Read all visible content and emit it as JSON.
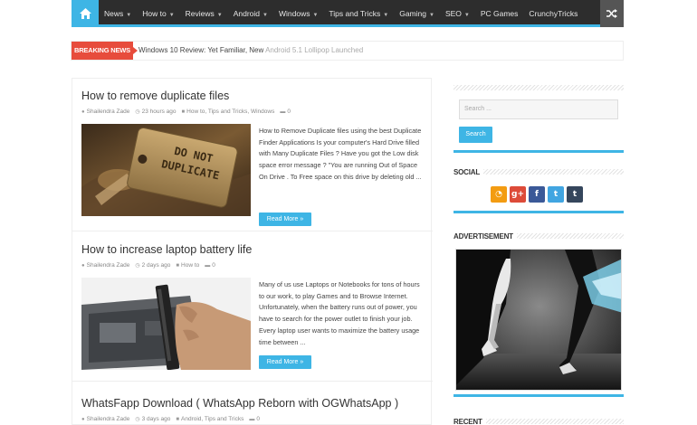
{
  "nav": {
    "items": [
      {
        "label": "News",
        "has_caret": true
      },
      {
        "label": "How to",
        "has_caret": true
      },
      {
        "label": "Reviews",
        "has_caret": true
      },
      {
        "label": "Android",
        "has_caret": true
      },
      {
        "label": "Windows",
        "has_caret": true
      },
      {
        "label": "Tips and Tricks",
        "has_caret": true
      },
      {
        "label": "Gaming",
        "has_caret": true
      },
      {
        "label": "SEO",
        "has_caret": true
      },
      {
        "label": "PC Games",
        "has_caret": false
      },
      {
        "label": "CrunchyTricks",
        "has_caret": false
      }
    ],
    "home_icon": "home-icon",
    "shuffle_icon": "shuffle-icon"
  },
  "breaking": {
    "label": "BREAKING NEWS",
    "ticker_main": "Windows 10 Review: Yet Familiar, New",
    "ticker_faded": "Android 5.1 Lollipop Launched"
  },
  "posts": [
    {
      "title": "How to remove duplicate files",
      "author": "Shailendra Zade",
      "time": "23 hours ago",
      "categories": "How to, Tips and Tricks, Windows",
      "comments": "0",
      "excerpt": "How to Remove Duplicate files using the best Duplicate Finder Applications Is your computer's Hard Drive filled with Many Duplicate Files ? Have you got the Low disk space error message ? \"You are running Out of Space On Drive . To Free space on this drive by deleting old ...",
      "read_more": "Read More »",
      "image_text": [
        "DO NOT",
        "DUPLICATE"
      ]
    },
    {
      "title": "How to increase laptop battery life",
      "author": "Shailendra Zade",
      "time": "2 days ago",
      "categories": "How to",
      "comments": "0",
      "excerpt": "Many of us use Laptops or Notebooks for tons of hours to our work, to play Games and to Browse Internet. Unfortunately, when the battery runs out of power, you have to search for the power outlet to finish your job. Every laptop user wants to maximize the battery usage time between ...",
      "read_more": "Read More »"
    },
    {
      "title": "WhatsFapp Download ( WhatsApp Reborn with OGWhatsApp )",
      "author": "Shailendra Zade",
      "time": "3 days ago",
      "categories": "Android, Tips and Tricks",
      "comments": "0"
    }
  ],
  "sidebar": {
    "search_placeholder": "Search ...",
    "search_button": "Search",
    "social_title": "SOCIAL",
    "social": [
      {
        "icon": "rss-icon",
        "glyph": "◔",
        "color": "#f39c12"
      },
      {
        "icon": "google-plus-icon",
        "glyph": "g+",
        "color": "#dd4b39"
      },
      {
        "icon": "facebook-icon",
        "glyph": "f",
        "color": "#3b5998"
      },
      {
        "icon": "twitter-icon",
        "glyph": "t",
        "color": "#41a5e1"
      },
      {
        "icon": "tumblr-icon",
        "glyph": "t",
        "color": "#35465c"
      }
    ],
    "ad_title": "ADVERTISEMENT",
    "recent_title": "RECENT"
  }
}
